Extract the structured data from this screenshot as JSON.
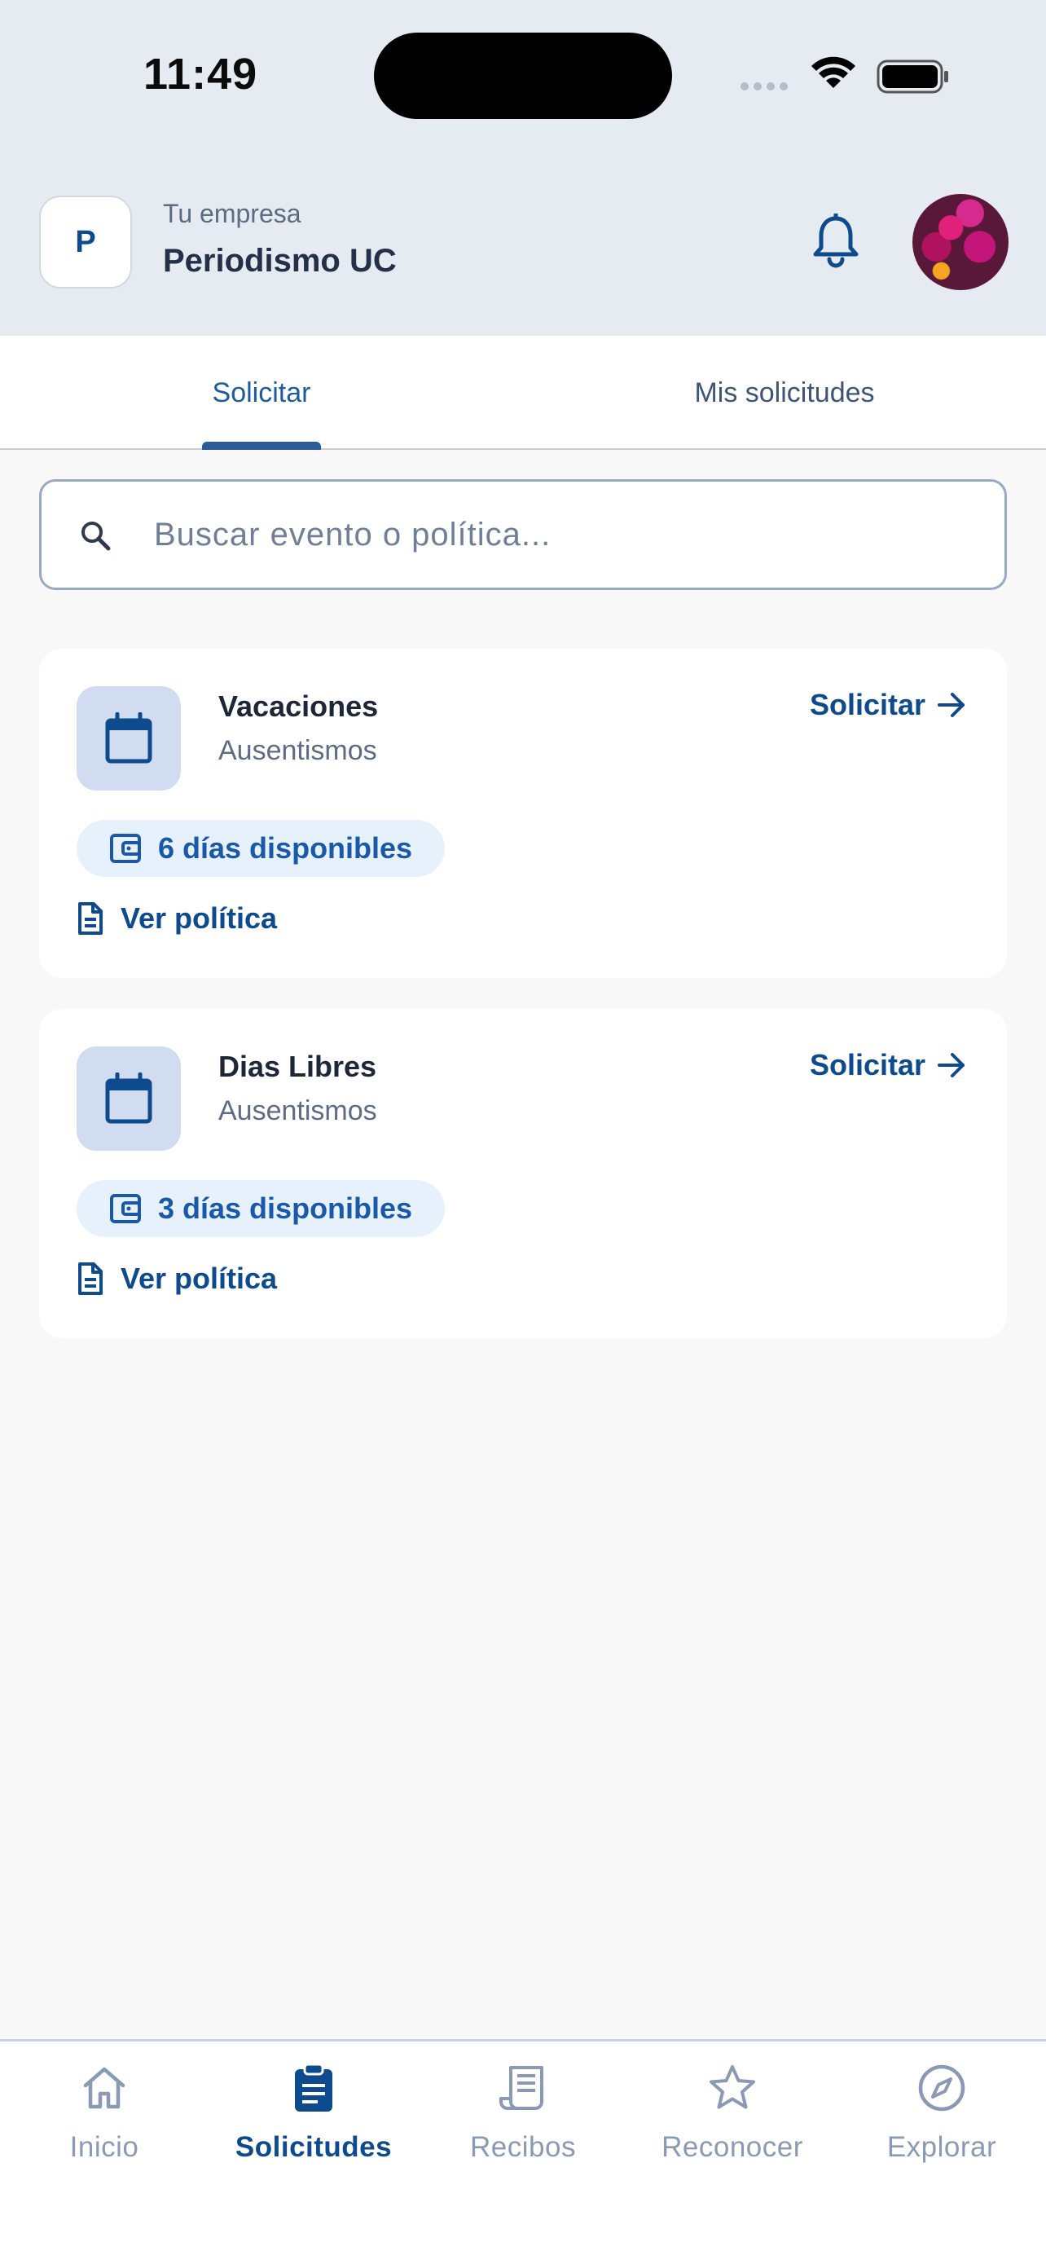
{
  "status_bar": {
    "time": "11:49"
  },
  "header": {
    "company_initial": "P",
    "company_caption": "Tu empresa",
    "company_name": "Periodismo UC"
  },
  "tabs": [
    {
      "label": "Solicitar",
      "active": true
    },
    {
      "label": "Mis solicitudes",
      "active": false
    }
  ],
  "search": {
    "placeholder": "Buscar evento o política...",
    "value": ""
  },
  "cards": [
    {
      "title": "Vacaciones",
      "subtitle": "Ausentismos",
      "action": "Solicitar",
      "availability": "6 días disponibles",
      "policy_link": "Ver política"
    },
    {
      "title": "Dias Libres",
      "subtitle": "Ausentismos",
      "action": "Solicitar",
      "availability": "3 días disponibles",
      "policy_link": "Ver política"
    }
  ],
  "bottom_nav": [
    {
      "label": "Inicio",
      "icon": "home-icon",
      "active": false
    },
    {
      "label": "Solicitudes",
      "icon": "clipboard-icon",
      "active": true
    },
    {
      "label": "Recibos",
      "icon": "receipt-icon",
      "active": false
    },
    {
      "label": "Reconocer",
      "icon": "star-icon",
      "active": false
    },
    {
      "label": "Explorar",
      "icon": "compass-icon",
      "active": false
    }
  ],
  "colors": {
    "primary": "#0d4a8e",
    "header_bg": "#e6ebf2",
    "pill_bg": "#e6f1fb",
    "icon_box_bg": "#d2dcf0",
    "inactive_nav": "#8a9ab4"
  }
}
